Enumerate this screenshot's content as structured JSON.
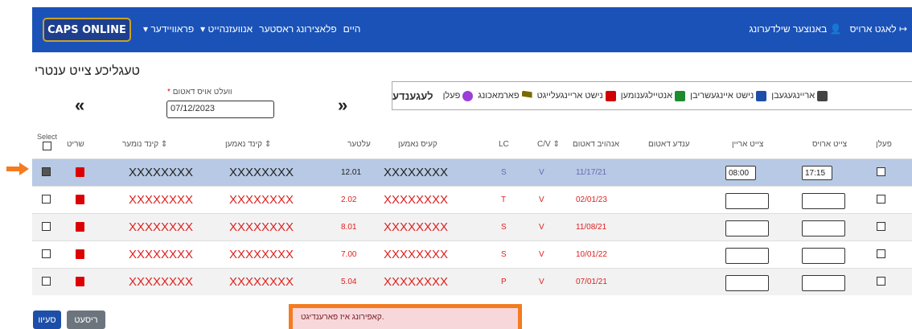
{
  "navbar": {
    "logo": "CAPS ONLINE",
    "left_menu": [
      "היים",
      "פלאצירונג ראסטער",
      "אנוועזנהייט ▾",
      "פראוויידער ▾"
    ],
    "user": "באנוצער שילדערונג",
    "logout": "לאגט ארויס"
  },
  "page_title": "טעגליכע צייט ענטרי",
  "controls": {
    "prev_arrow": "«",
    "next_arrow": "»",
    "date_label": "וועלט אויס דאטום",
    "date_required": "*",
    "date_value": "07/12/2023"
  },
  "legend": {
    "title": "לעגענדע",
    "items": [
      {
        "label": "אריינגעגעבן",
        "icon": "checkbox-icon"
      },
      {
        "label": "נישט איינגעשריבן",
        "icon": "calendar-x-icon"
      },
      {
        "label": "אנטיילגענומען",
        "icon": "calendar-green-icon"
      },
      {
        "label": "נישט אריינגעלייגט",
        "icon": "calendar-red-icon"
      },
      {
        "label": "פארמאכונג",
        "icon": "flag-icon"
      },
      {
        "label": "פעלן",
        "icon": "sad-face-icon"
      }
    ]
  },
  "table": {
    "headers": {
      "select": "Select",
      "write": "שריט",
      "child_number": "קינד נומער ⇕",
      "child_name": "קינד נאמען ⇕",
      "rate": "עלטער",
      "provider_name": "קעיס נאמען",
      "lc": "LC",
      "cv": "C/V ⇕",
      "start_date": "אנהויב דאטום",
      "end_date": "ענדע דאטום",
      "time_in": "צייט אריין",
      "time_out": "צייט ארויס",
      "absent": "פעלן"
    },
    "rows": [
      {
        "selected": true,
        "child_number": "XXXXXXXX",
        "child_name": "XXXXXXXX",
        "rate": "12.01",
        "case_name": "XXXXXXXX",
        "lc": "S",
        "cv": "V",
        "start": "11/17/21",
        "time_in": "08:00",
        "time_out": "17:15"
      },
      {
        "selected": false,
        "child_number": "XXXXXXXX",
        "child_name": "XXXXXXXX",
        "rate": "2.02",
        "case_name": "XXXXXXXX",
        "lc": "T",
        "cv": "V",
        "start": "02/01/23",
        "time_in": "",
        "time_out": ""
      },
      {
        "selected": false,
        "child_number": "XXXXXXXX",
        "child_name": "XXXXXXXX",
        "rate": "8.01",
        "case_name": "XXXXXXXX",
        "lc": "S",
        "cv": "V",
        "start": "11/08/21",
        "time_in": "",
        "time_out": ""
      },
      {
        "selected": false,
        "child_number": "XXXXXXXX",
        "child_name": "XXXXXXXX",
        "rate": "7.00",
        "case_name": "XXXXXXXX",
        "lc": "S",
        "cv": "V",
        "start": "10/01/22",
        "time_in": "",
        "time_out": ""
      },
      {
        "selected": false,
        "child_number": "XXXXXXXX",
        "child_name": "XXXXXXXX",
        "rate": "5.04",
        "case_name": "XXXXXXXX",
        "lc": "P",
        "cv": "V",
        "start": "07/01/21",
        "time_in": "",
        "time_out": ""
      }
    ]
  },
  "buttons": {
    "save": "סעיוו",
    "reset": "ריסעט"
  },
  "error_message": "קאפירונג איז פארענדיגט.",
  "colors": {
    "navbar": "#1a52b8",
    "selected_row": "#b7c9e4",
    "pointer_arrow": "#f47b20",
    "error_border": "#f47b20"
  }
}
